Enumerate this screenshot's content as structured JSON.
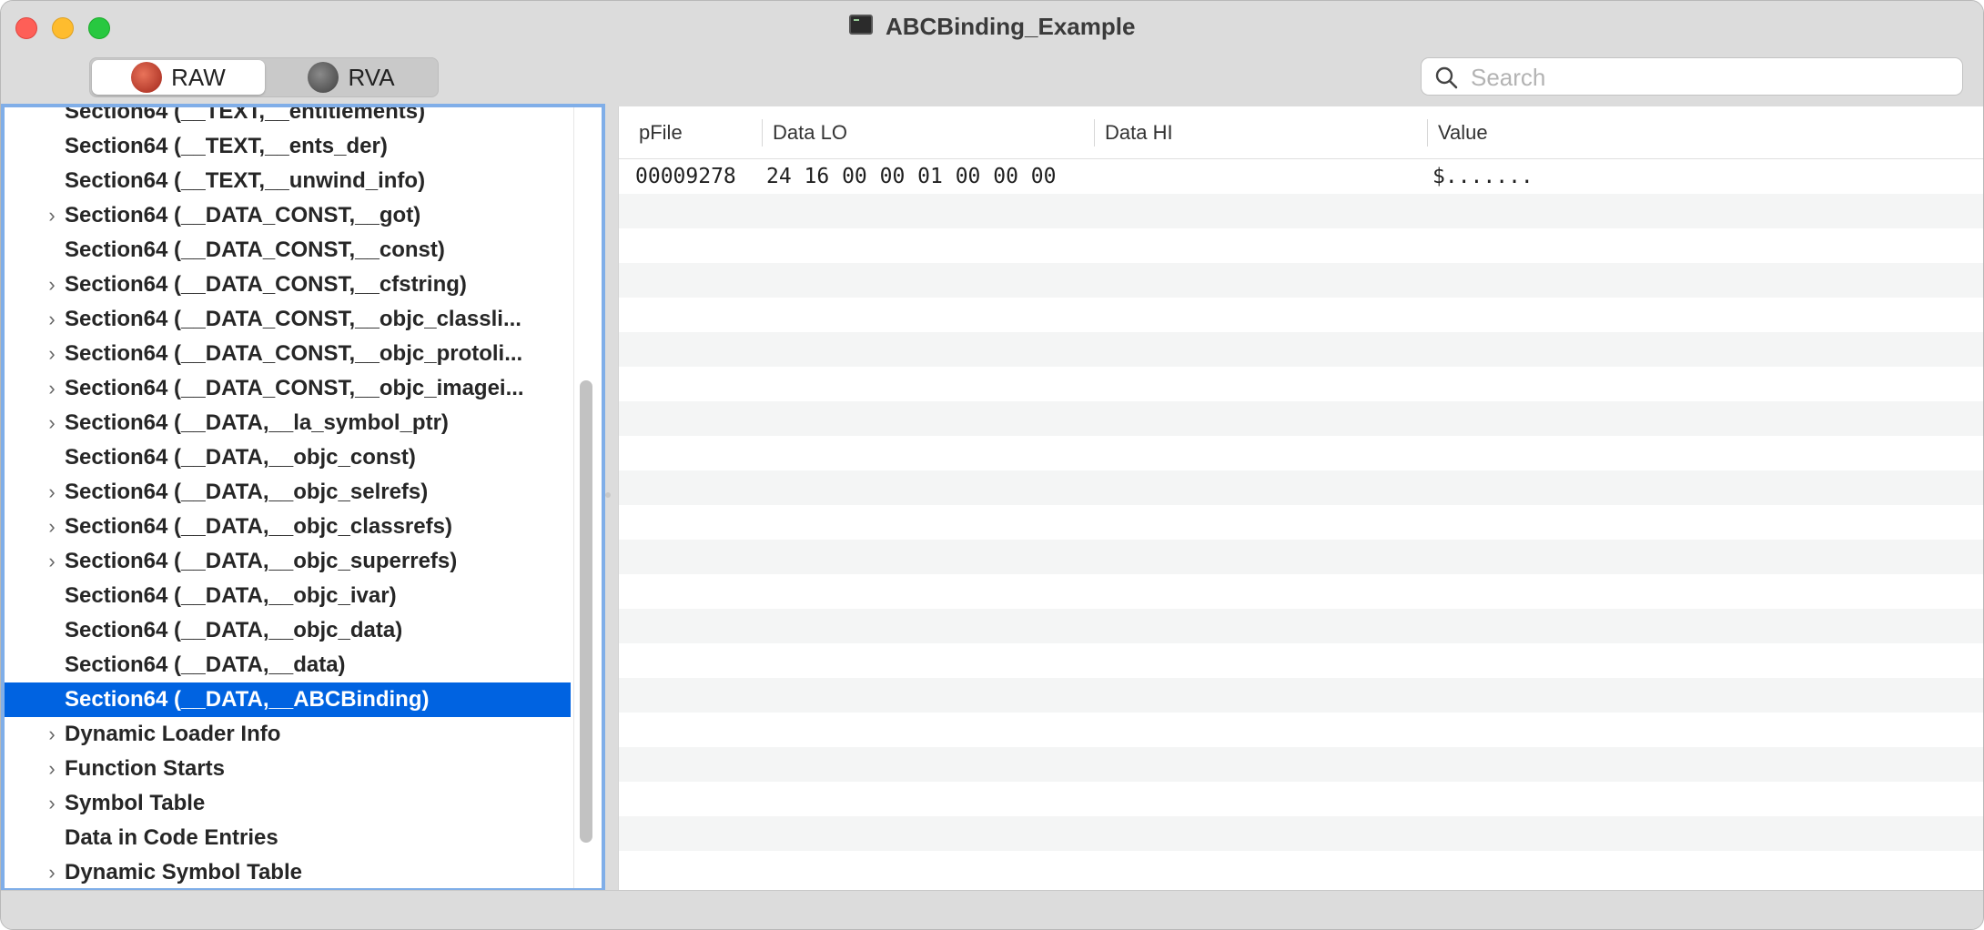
{
  "window": {
    "title": "ABCBinding_Example"
  },
  "toolbar": {
    "modes": [
      {
        "label": "RAW",
        "active": true
      },
      {
        "label": "RVA",
        "active": false
      }
    ],
    "search": {
      "placeholder": "Search",
      "value": ""
    }
  },
  "sidebar": {
    "items": [
      {
        "label": "Section64 (__TEXT,__entitlements)",
        "expandable": false,
        "selected": false
      },
      {
        "label": "Section64 (__TEXT,__ents_der)",
        "expandable": false,
        "selected": false
      },
      {
        "label": "Section64 (__TEXT,__unwind_info)",
        "expandable": false,
        "selected": false
      },
      {
        "label": "Section64 (__DATA_CONST,__got)",
        "expandable": true,
        "selected": false
      },
      {
        "label": "Section64 (__DATA_CONST,__const)",
        "expandable": false,
        "selected": false
      },
      {
        "label": "Section64 (__DATA_CONST,__cfstring)",
        "expandable": true,
        "selected": false
      },
      {
        "label": "Section64 (__DATA_CONST,__objc_classli...",
        "expandable": true,
        "selected": false
      },
      {
        "label": "Section64 (__DATA_CONST,__objc_protoli...",
        "expandable": true,
        "selected": false
      },
      {
        "label": "Section64 (__DATA_CONST,__objc_imagei...",
        "expandable": true,
        "selected": false
      },
      {
        "label": "Section64 (__DATA,__la_symbol_ptr)",
        "expandable": true,
        "selected": false
      },
      {
        "label": "Section64 (__DATA,__objc_const)",
        "expandable": false,
        "selected": false
      },
      {
        "label": "Section64 (__DATA,__objc_selrefs)",
        "expandable": true,
        "selected": false
      },
      {
        "label": "Section64 (__DATA,__objc_classrefs)",
        "expandable": true,
        "selected": false
      },
      {
        "label": "Section64 (__DATA,__objc_superrefs)",
        "expandable": true,
        "selected": false
      },
      {
        "label": "Section64 (__DATA,__objc_ivar)",
        "expandable": false,
        "selected": false
      },
      {
        "label": "Section64 (__DATA,__objc_data)",
        "expandable": false,
        "selected": false
      },
      {
        "label": "Section64 (__DATA,__data)",
        "expandable": false,
        "selected": false
      },
      {
        "label": "Section64 (__DATA,__ABCBinding)",
        "expandable": false,
        "selected": true
      },
      {
        "label": "Dynamic Loader Info",
        "expandable": true,
        "selected": false
      },
      {
        "label": "Function Starts",
        "expandable": true,
        "selected": false
      },
      {
        "label": "Symbol Table",
        "expandable": true,
        "selected": false
      },
      {
        "label": "Data in Code Entries",
        "expandable": false,
        "selected": false
      },
      {
        "label": "Dynamic Symbol Table",
        "expandable": true,
        "selected": false
      }
    ]
  },
  "table": {
    "columns": [
      "pFile",
      "Data LO",
      "Data HI",
      "Value"
    ],
    "rows": [
      {
        "pFile": "00009278",
        "data_lo": "24 16 00 00 01 00 00 00",
        "data_hi": "",
        "value": "$......."
      }
    ]
  }
}
